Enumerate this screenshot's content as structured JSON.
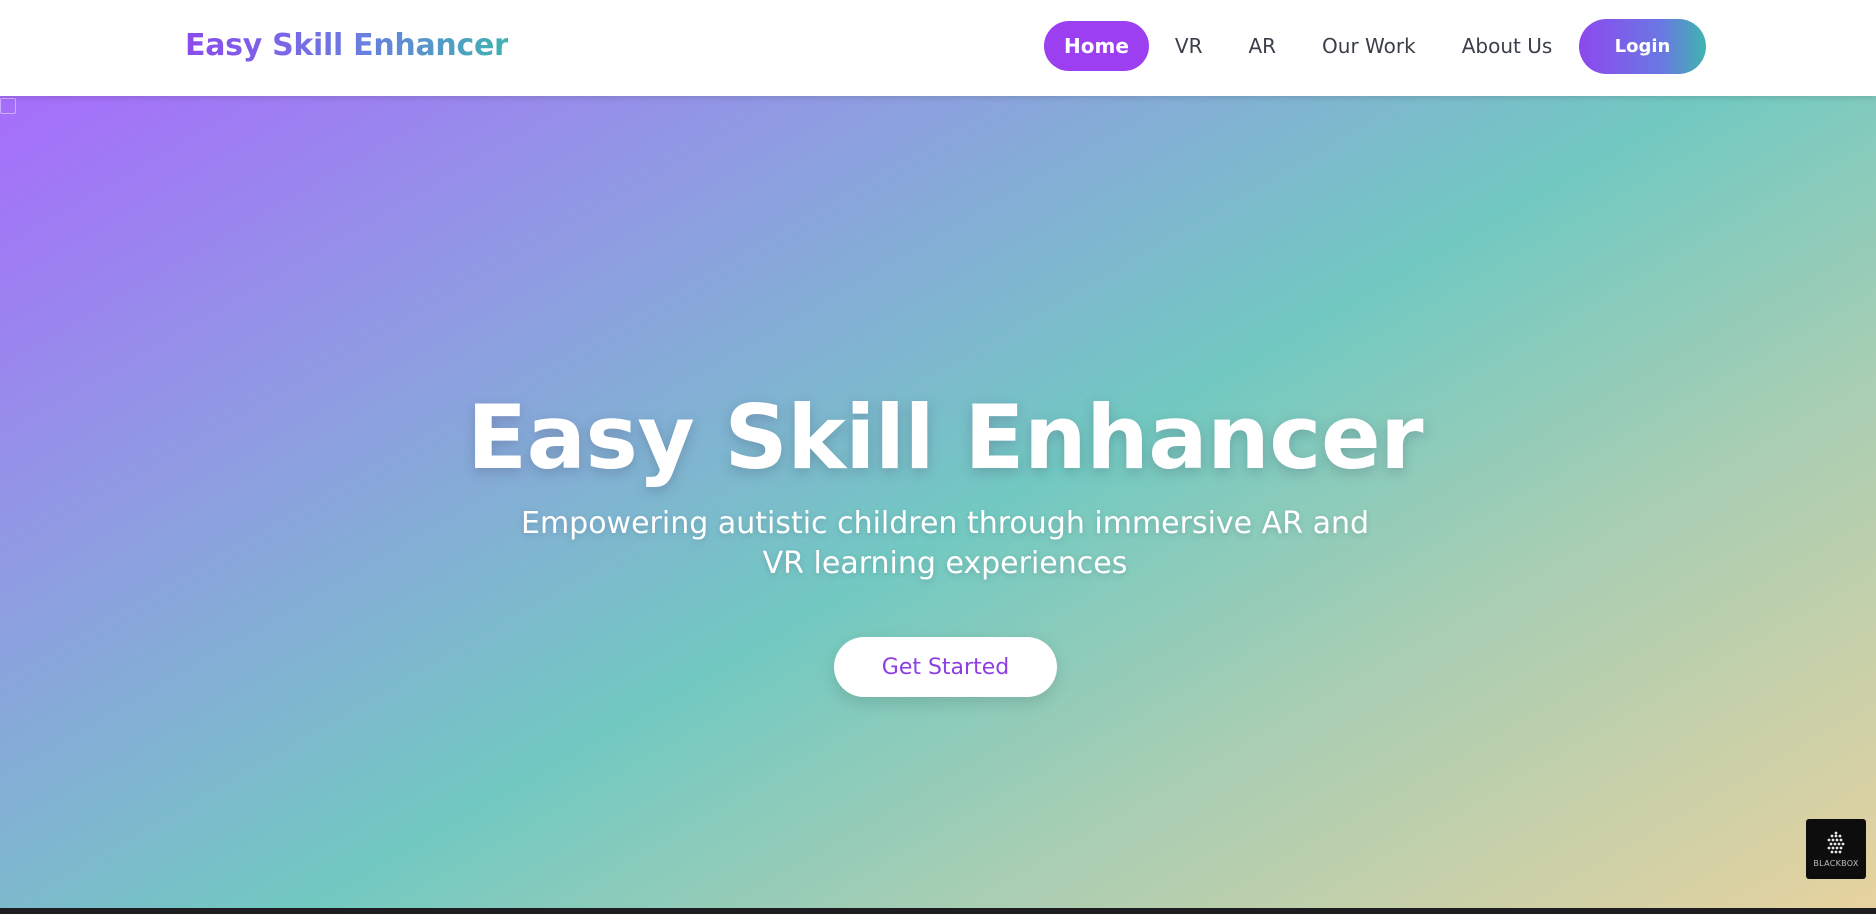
{
  "header": {
    "brand": "Easy Skill Enhancer",
    "nav": [
      {
        "label": "Home",
        "active": true
      },
      {
        "label": "VR",
        "active": false
      },
      {
        "label": "AR",
        "active": false
      },
      {
        "label": "Our Work",
        "active": false
      },
      {
        "label": "About Us",
        "active": false
      }
    ],
    "login_label": "Login"
  },
  "hero": {
    "title": "Easy Skill Enhancer",
    "subtitle": "Empowering autistic children through immersive AR and VR learning experiences",
    "cta_label": "Get Started",
    "broken_image_icon": "broken-image-icon"
  },
  "badge": {
    "label": "BLACKBOX",
    "icon": "blackbox-logo-icon"
  },
  "colors": {
    "accent_purple": "#9b3ff0",
    "brand_teal": "#3fb3b0",
    "cta_text": "#8d3fe6",
    "hero_gradient_start": "#a66dfb",
    "hero_gradient_end": "#e6d29f"
  }
}
